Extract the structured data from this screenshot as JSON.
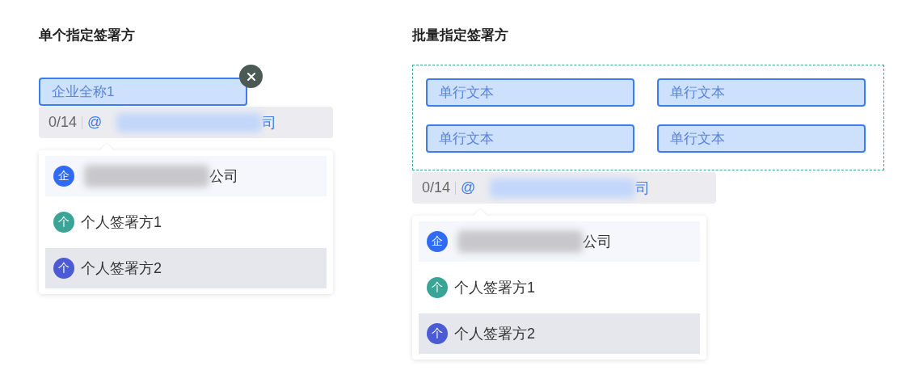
{
  "sections": [
    {
      "title": "单个指定签署方",
      "kind": "single",
      "fields": [
        {
          "value": "企业全称1",
          "removable": true
        }
      ],
      "counter": {
        "count": "0/14",
        "at": "@",
        "tail": "司"
      },
      "options": [
        {
          "kind": "company",
          "icon": "企",
          "color": "#2f6bf5",
          "suffix": "公司",
          "selected": false
        },
        {
          "kind": "person",
          "icon": "个",
          "color": "#3aa496",
          "label": "个人签署方1",
          "selected": false
        },
        {
          "kind": "person",
          "icon": "个",
          "color": "#4a5bd4",
          "label": "个人签署方2",
          "selected": true
        }
      ]
    },
    {
      "title": "批量指定签署方",
      "kind": "batch",
      "fields": [
        {
          "value": "单行文本",
          "removable": false
        },
        {
          "value": "单行文本",
          "removable": false
        },
        {
          "value": "单行文本",
          "removable": false
        },
        {
          "value": "单行文本",
          "removable": false
        }
      ],
      "counter": {
        "count": "0/14",
        "at": "@",
        "tail": "司"
      },
      "options": [
        {
          "kind": "company",
          "icon": "企",
          "color": "#2f6bf5",
          "suffix": "公司",
          "selected": false
        },
        {
          "kind": "person",
          "icon": "个",
          "color": "#3aa496",
          "label": "个人签署方1",
          "selected": false
        },
        {
          "kind": "person",
          "icon": "个",
          "color": "#4a5bd4",
          "label": "个人签署方2",
          "selected": true
        }
      ]
    }
  ]
}
